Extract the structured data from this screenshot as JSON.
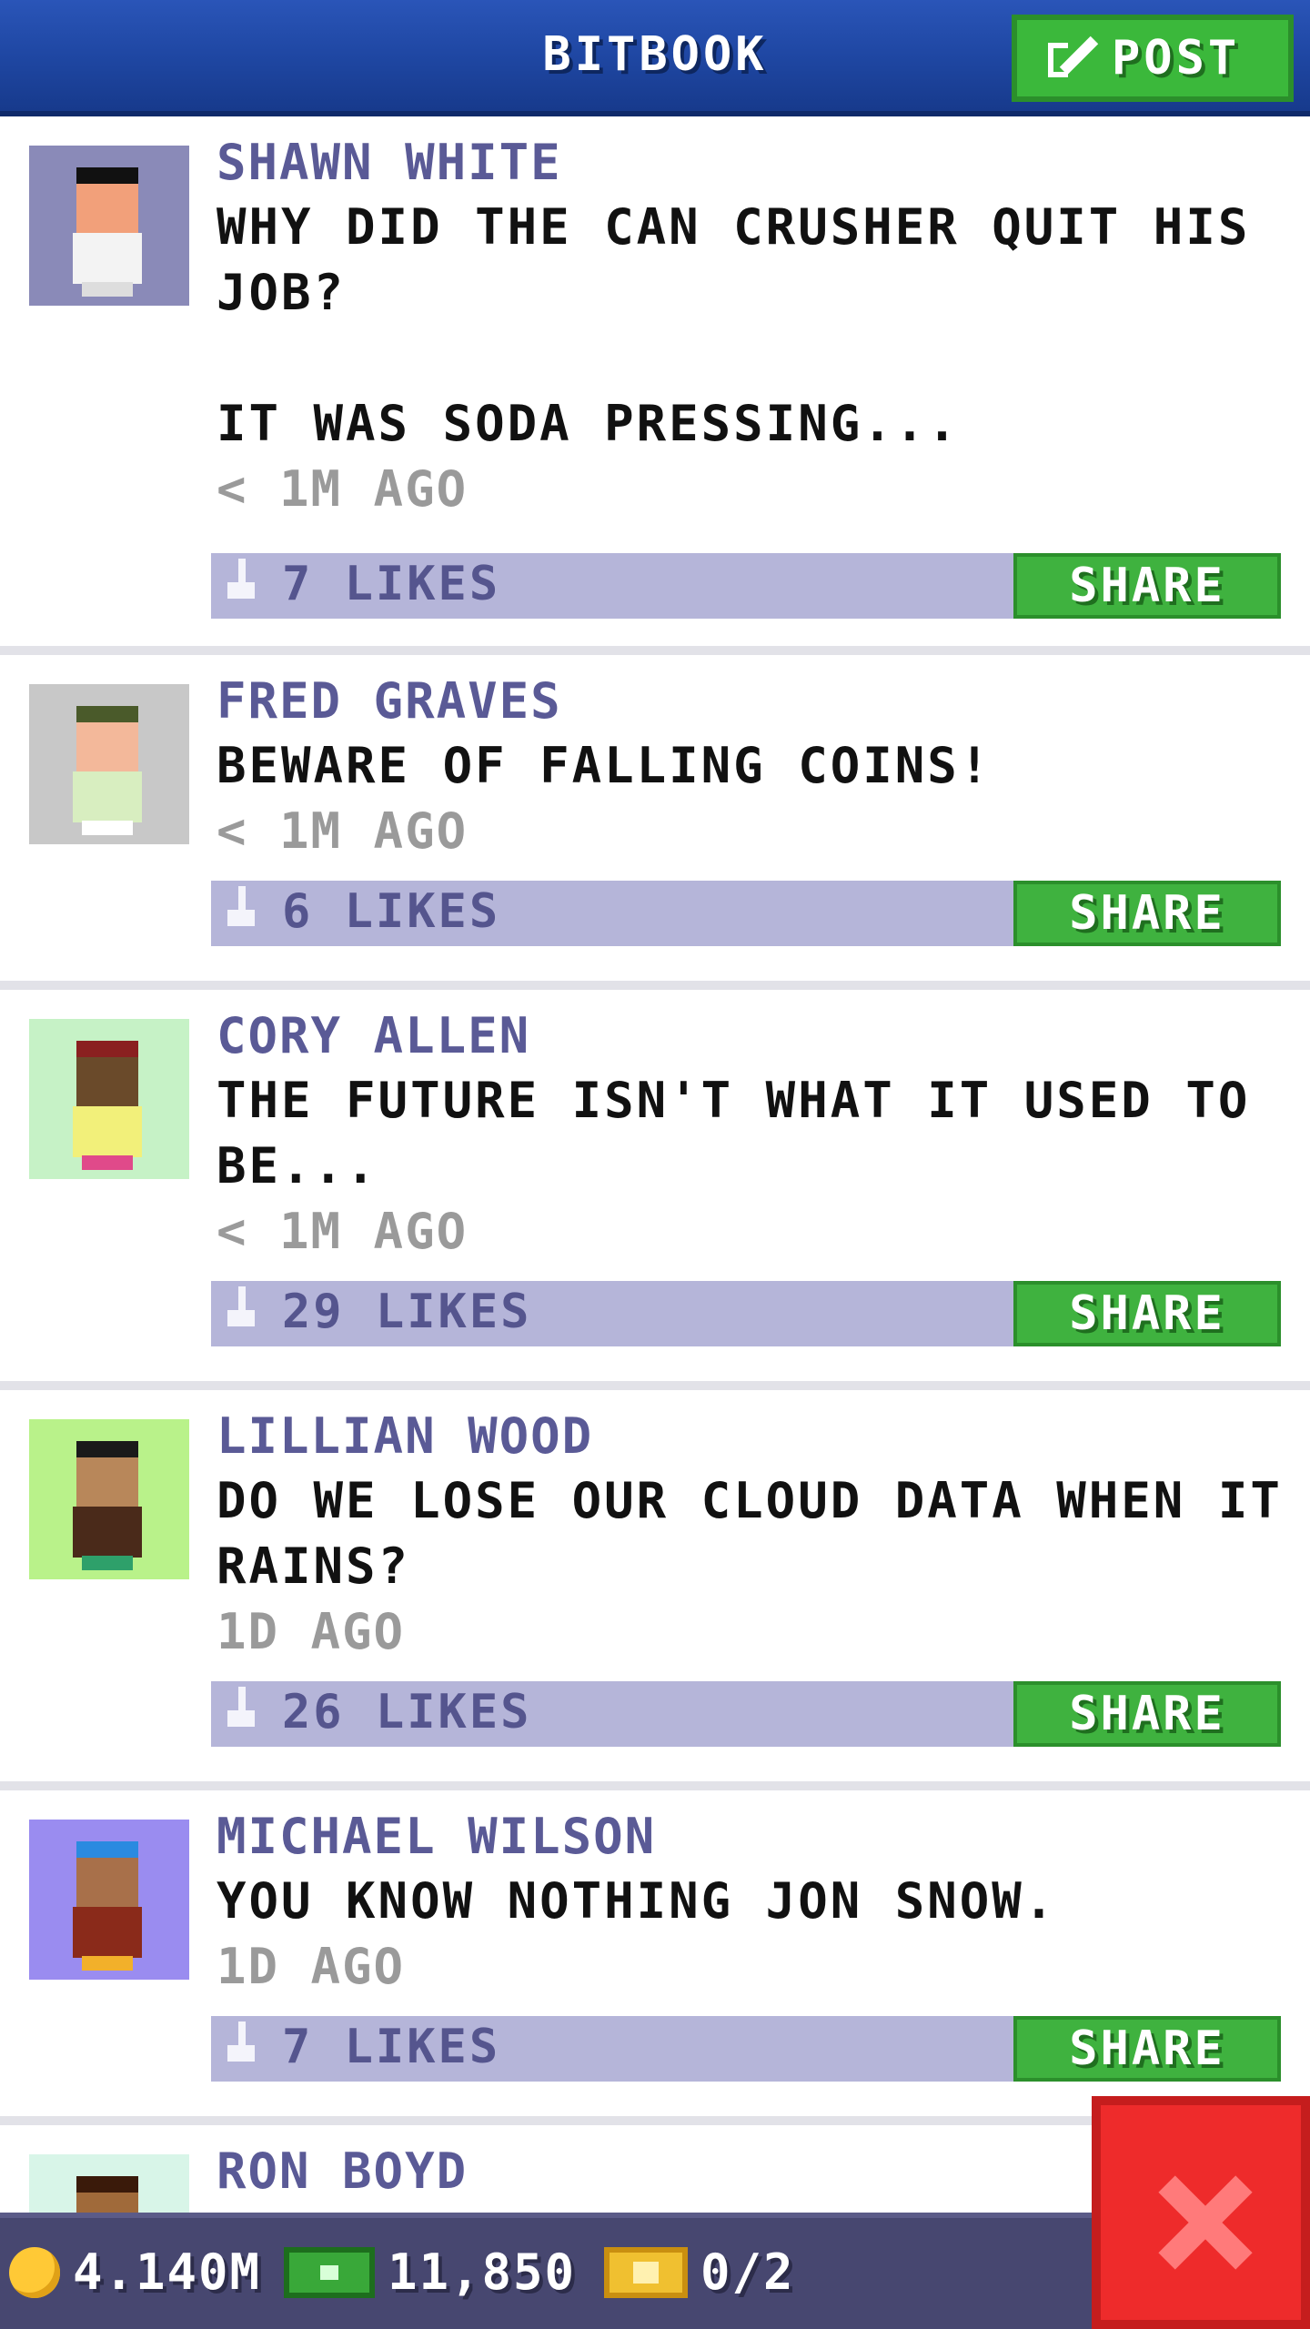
{
  "header": {
    "title": "BITBOOK",
    "post_label": "POST"
  },
  "posts": [
    {
      "name": "SHAWN WHITE",
      "message": "WHY DID THE CAN CRUSHER QUIT HIS JOB?\n\nIT WAS SODA PRESSING...",
      "time": "< 1M AGO",
      "likes": "7 LIKES",
      "share": "SHARE",
      "avatar_bg": "#8a8ab8"
    },
    {
      "name": "FRED GRAVES",
      "message": "BEWARE OF FALLING COINS!",
      "time": "< 1M AGO",
      "likes": "6 LIKES",
      "share": "SHARE",
      "avatar_bg": "#c8c8c8"
    },
    {
      "name": "CORY ALLEN",
      "message": "THE FUTURE ISN'T WHAT IT USED TO BE...",
      "time": "< 1M AGO",
      "likes": "29 LIKES",
      "share": "SHARE",
      "avatar_bg": "#c6f2c6"
    },
    {
      "name": "LILLIAN WOOD",
      "message": "DO WE LOSE OUR CLOUD DATA WHEN IT RAINS?",
      "time": "1D AGO",
      "likes": "26 LIKES",
      "share": "SHARE",
      "avatar_bg": "#b9f28a"
    },
    {
      "name": "MICHAEL WILSON",
      "message": "YOU KNOW NOTHING JON SNOW.",
      "time": "1D AGO",
      "likes": "7 LIKES",
      "share": "SHARE",
      "avatar_bg": "#9a8cf0"
    },
    {
      "name": "RON BOYD",
      "message": "",
      "time": "",
      "likes": "",
      "share": "",
      "avatar_bg": "#d8f5e8"
    }
  ],
  "bottom": {
    "coins": "4.140M",
    "bux": "11,850",
    "tickets": "0/2"
  },
  "colors": {
    "header": "#1f47a3",
    "accent_green": "#3fb23f",
    "close_red": "#ee2b2b"
  }
}
